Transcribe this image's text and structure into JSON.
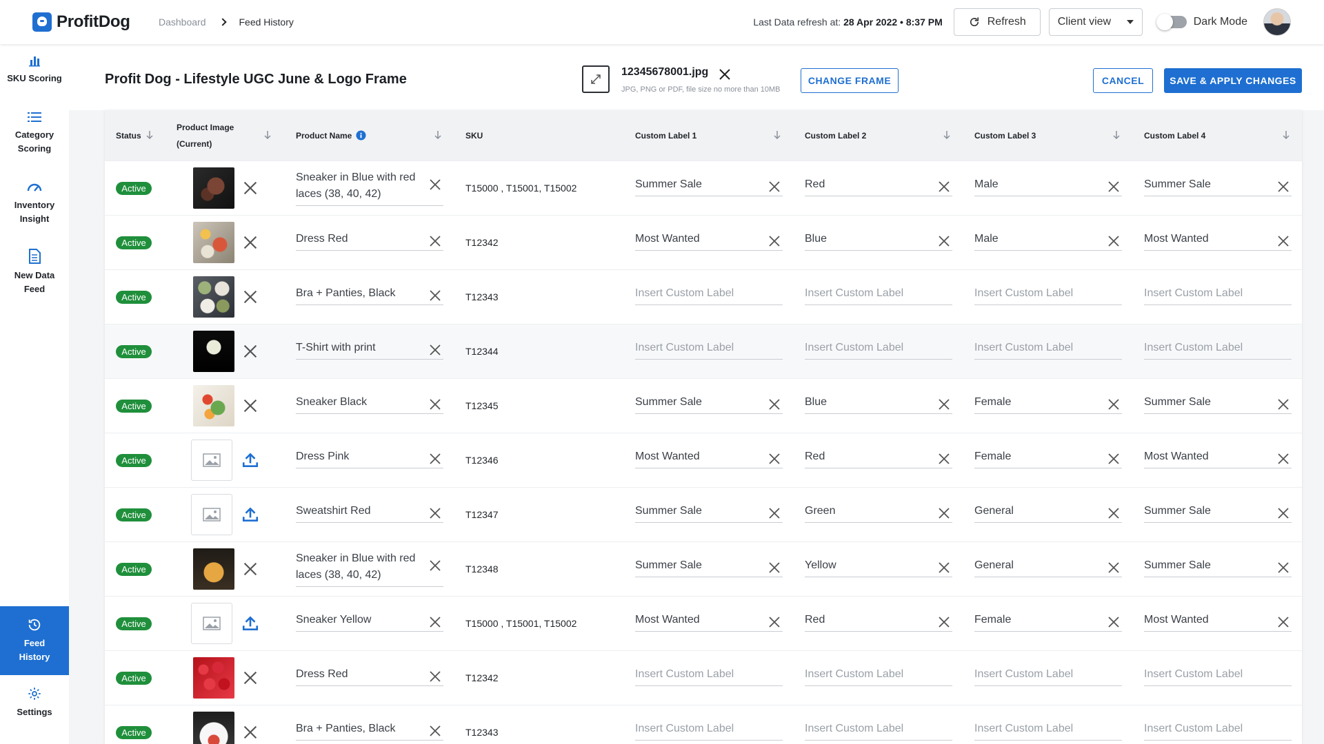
{
  "app": {
    "name": "ProfitDog"
  },
  "breadcrumb": {
    "root": "Dashboard",
    "current": "Feed History"
  },
  "refresh": {
    "label": "Last Data refresh at:",
    "datetime": "28 Apr 2022 • 8:37 PM",
    "button": "Refresh"
  },
  "view_select": {
    "value": "Client view"
  },
  "dark_mode": {
    "label": "Dark Mode",
    "enabled": false
  },
  "sidebar": {
    "items": [
      {
        "label": "SKU Scoring",
        "icon": "bar-chart-icon"
      },
      {
        "label": "Category Scoring",
        "icon": "list-icon"
      },
      {
        "label": "Inventory Insight",
        "icon": "gauge-icon"
      },
      {
        "label": "New Data Feed",
        "icon": "document-icon"
      },
      {
        "label": "Feed History",
        "icon": "history-icon",
        "active": true
      },
      {
        "label": "Settings",
        "icon": "gear-icon"
      }
    ]
  },
  "page": {
    "title": "Profit Dog - Lifestyle UGC June & Logo Frame",
    "frame_file": "12345678001.jpg",
    "frame_hint": "JPG, PNG or PDF, file size no more than 10MB",
    "change_frame": "CHANGE FRAME",
    "cancel": "CANCEL",
    "save": "SAVE & APPLY CHANGES"
  },
  "table": {
    "headers": {
      "status": "Status",
      "image_line1": "Product Image",
      "image_line2": "(Current)",
      "name": "Product Name",
      "sku": "SKU",
      "cl1": "Custom Label 1",
      "cl2": "Custom Label 2",
      "cl3": "Custom Label 3",
      "cl4": "Custom Label 4"
    },
    "placeholder": "Insert Custom Label",
    "rows": [
      {
        "status": "Active",
        "image": "steak",
        "name1": "Sneaker in Blue with red",
        "name2": "laces (38, 40, 42)",
        "sku": "T15000 , T15001, T15002",
        "cl1": "Summer Sale",
        "cl2": "Red",
        "cl3": "Male",
        "cl4": "Summer Sale"
      },
      {
        "status": "Active",
        "image": "breakfast",
        "name1": "Dress Red",
        "name2": "",
        "sku": "T12342",
        "cl1": "Most Wanted",
        "cl2": "Blue",
        "cl3": "Male",
        "cl4": "Most Wanted"
      },
      {
        "status": "Active",
        "image": "dishes",
        "name1": "Bra + Panties, Black",
        "name2": "",
        "sku": "T12343",
        "cl1": "",
        "cl2": "",
        "cl3": "",
        "cl4": ""
      },
      {
        "status": "Active",
        "image": "drink",
        "name1": "T-Shirt with print",
        "name2": "",
        "sku": "T12344",
        "cl1": "",
        "cl2": "",
        "cl3": "",
        "cl4": ""
      },
      {
        "status": "Active",
        "image": "salad",
        "name1": "Sneaker Black",
        "name2": "",
        "sku": "T12345",
        "cl1": "Summer Sale",
        "cl2": "Blue",
        "cl3": "Female",
        "cl4": "Summer Sale"
      },
      {
        "status": "Active",
        "image": "",
        "name1": "Dress Pink",
        "name2": "",
        "sku": "T12346",
        "cl1": "Most Wanted",
        "cl2": "Red",
        "cl3": "Female",
        "cl4": "Most Wanted"
      },
      {
        "status": "Active",
        "image": "",
        "name1": "Sweatshirt Red",
        "name2": "",
        "sku": "T12347",
        "cl1": "Summer Sale",
        "cl2": "Green",
        "cl3": "General",
        "cl4": "Summer Sale"
      },
      {
        "status": "Active",
        "image": "pasta",
        "name1": "Sneaker in Blue with red",
        "name2": "laces (38, 40, 42)",
        "sku": "T12348",
        "cl1": "Summer Sale",
        "cl2": "Yellow",
        "cl3": "General",
        "cl4": "Summer Sale"
      },
      {
        "status": "Active",
        "image": "",
        "name1": "Sneaker Yellow",
        "name2": "",
        "sku": "T15000 , T15001, T15002",
        "cl1": "Most Wanted",
        "cl2": "Red",
        "cl3": "Female",
        "cl4": "Most Wanted"
      },
      {
        "status": "Active",
        "image": "strawberries",
        "name1": "Dress Red",
        "name2": "",
        "sku": "T12342",
        "cl1": "",
        "cl2": "",
        "cl3": "",
        "cl4": ""
      },
      {
        "status": "Active",
        "image": "plate",
        "name1": "Bra + Panties, Black",
        "name2": "",
        "sku": "T12343",
        "cl1": "",
        "cl2": "",
        "cl3": "",
        "cl4": ""
      }
    ]
  },
  "colors": {
    "accent": "#1e6fd1",
    "active_badge": "#1f8f3b"
  }
}
